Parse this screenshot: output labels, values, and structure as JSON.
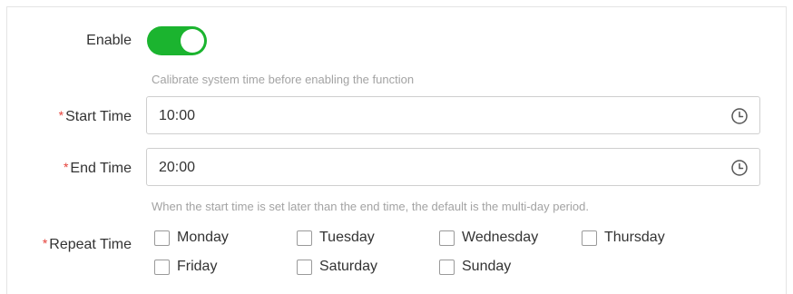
{
  "enable": {
    "label": "Enable",
    "state": "on",
    "accent_color": "#1bb42f"
  },
  "calibrate_hint": "Calibrate system time before enabling the function",
  "start_time": {
    "required_mark": "*",
    "label": "Start Time",
    "value": "10:00",
    "icon": "clock-icon"
  },
  "end_time": {
    "required_mark": "*",
    "label": "End Time",
    "value": "20:00",
    "icon": "clock-icon"
  },
  "period_hint": "When the start time is set later than the end time, the default is the multi-day period.",
  "repeat_time": {
    "required_mark": "*",
    "label": "Repeat Time",
    "days": [
      {
        "label": "Monday",
        "checked": false
      },
      {
        "label": "Tuesday",
        "checked": false
      },
      {
        "label": "Wednesday",
        "checked": false
      },
      {
        "label": "Thursday",
        "checked": false
      },
      {
        "label": "Friday",
        "checked": false
      },
      {
        "label": "Saturday",
        "checked": false
      },
      {
        "label": "Sunday",
        "checked": false
      }
    ]
  },
  "colors": {
    "required": "#e5413a",
    "hint": "#a3a3a3",
    "border": "#cfcfcf"
  }
}
